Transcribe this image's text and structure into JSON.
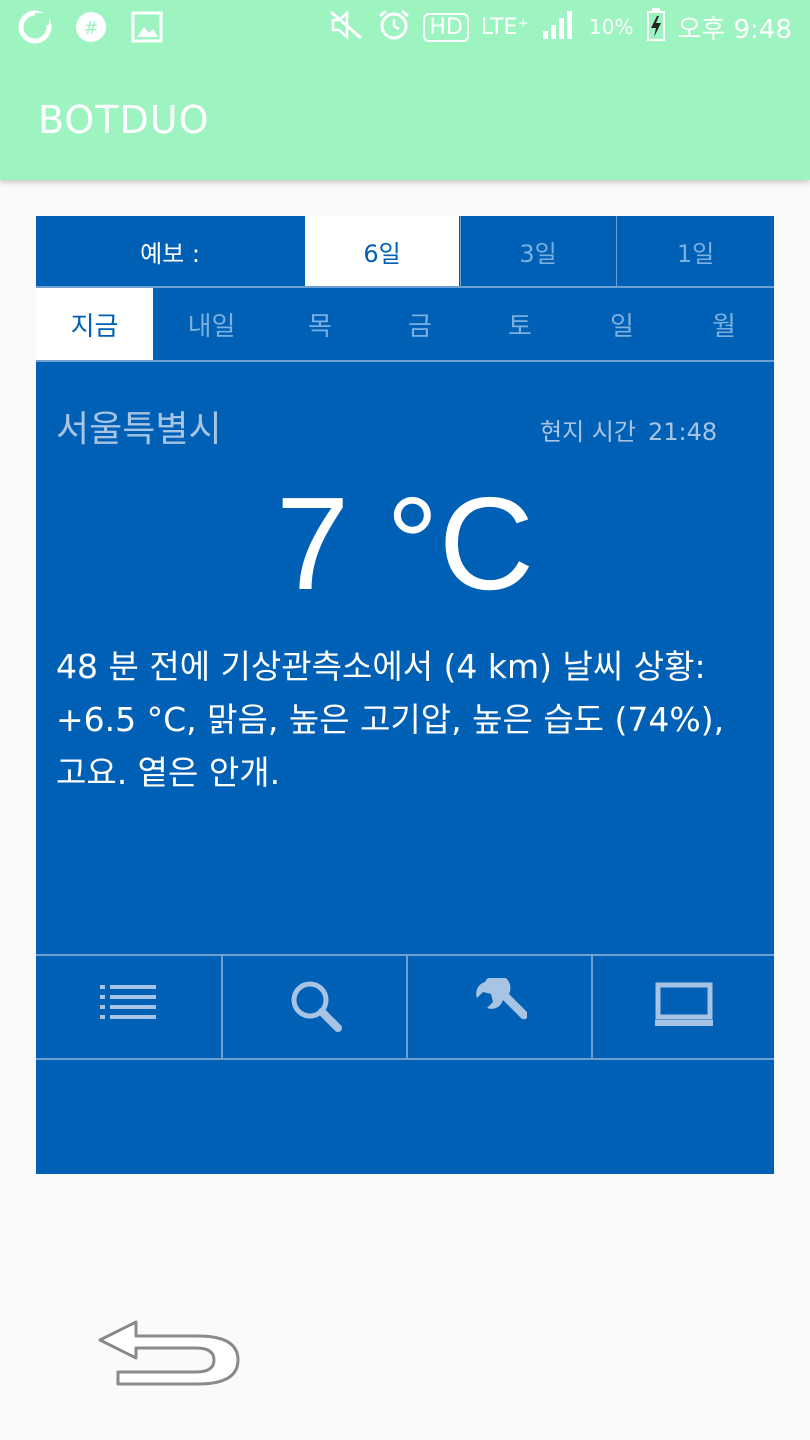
{
  "status_bar": {
    "icons_left": [
      "chat-app-icon",
      "settings-app-icon",
      "image-icon"
    ],
    "icons_right": [
      "mute-vibrate-icon",
      "alarm-icon",
      "hd-icon",
      "lte-icon",
      "signal-icon"
    ],
    "hd": "HD",
    "network": "LTE⁺",
    "battery": "10%",
    "time": "오후 9:48"
  },
  "app_bar": {
    "title": "BOTDUO"
  },
  "forecast": {
    "label": "예보 :",
    "options": [
      "6일",
      "3일",
      "1일"
    ],
    "selected": "6일"
  },
  "day_tabs": [
    "지금",
    "내일",
    "목",
    "금",
    "토",
    "일",
    "월"
  ],
  "selected_day": "지금",
  "weather": {
    "city": "서울특별시",
    "local_time_label": "현지 시간",
    "local_time": "21:48",
    "temperature": "7 °C",
    "description": "48 분 전에 기상관측소에서 (4 km) 날씨 상황: +6.5 °C, 맑음, 높은 고기압, 높은 습도 (74%), 고요. 옅은 안개."
  },
  "toolbar": {
    "buttons": [
      "list-icon",
      "search-icon",
      "wrench-icon",
      "monitor-icon"
    ]
  },
  "colors": {
    "app_bar": "#9ef4c0",
    "panel": "#0060b6",
    "divider": "#6f9fd0",
    "muted_text": "#7ab0e0"
  }
}
